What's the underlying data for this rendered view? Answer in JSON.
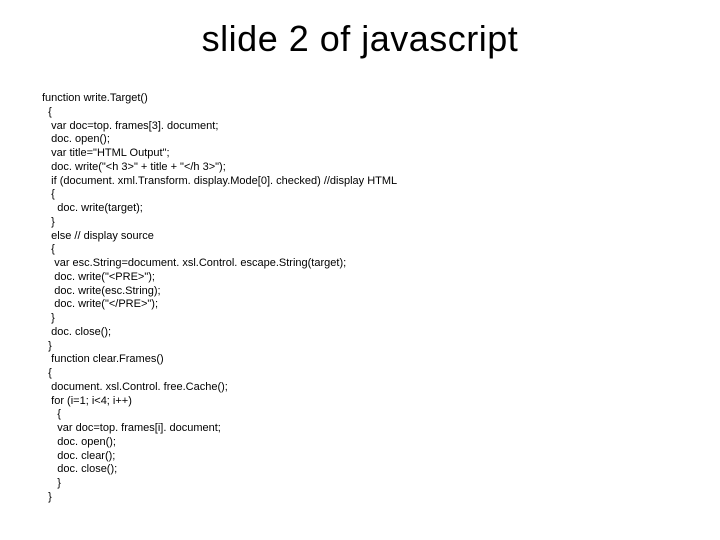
{
  "title": "slide 2 of javascript",
  "code": "function write.Target()\n  {\n   var doc=top. frames[3]. document;\n   doc. open();\n   var title=\"HTML Output\";\n   doc. write(\"<h 3>\" + title + \"</h 3>\");\n   if (document. xml.Transform. display.Mode[0]. checked) //display HTML\n   {\n     doc. write(target);\n   }\n   else // display source\n   {\n    var esc.String=document. xsl.Control. escape.String(target);\n    doc. write(\"<PRE>\");\n    doc. write(esc.String);\n    doc. write(\"</PRE>\");\n   }\n   doc. close();\n  }\n   function clear.Frames()\n  {\n   document. xsl.Control. free.Cache();\n   for (i=1; i<4; i++)\n     {\n     var doc=top. frames[i]. document;\n     doc. open();\n     doc. clear();\n     doc. close();\n     }\n  }"
}
